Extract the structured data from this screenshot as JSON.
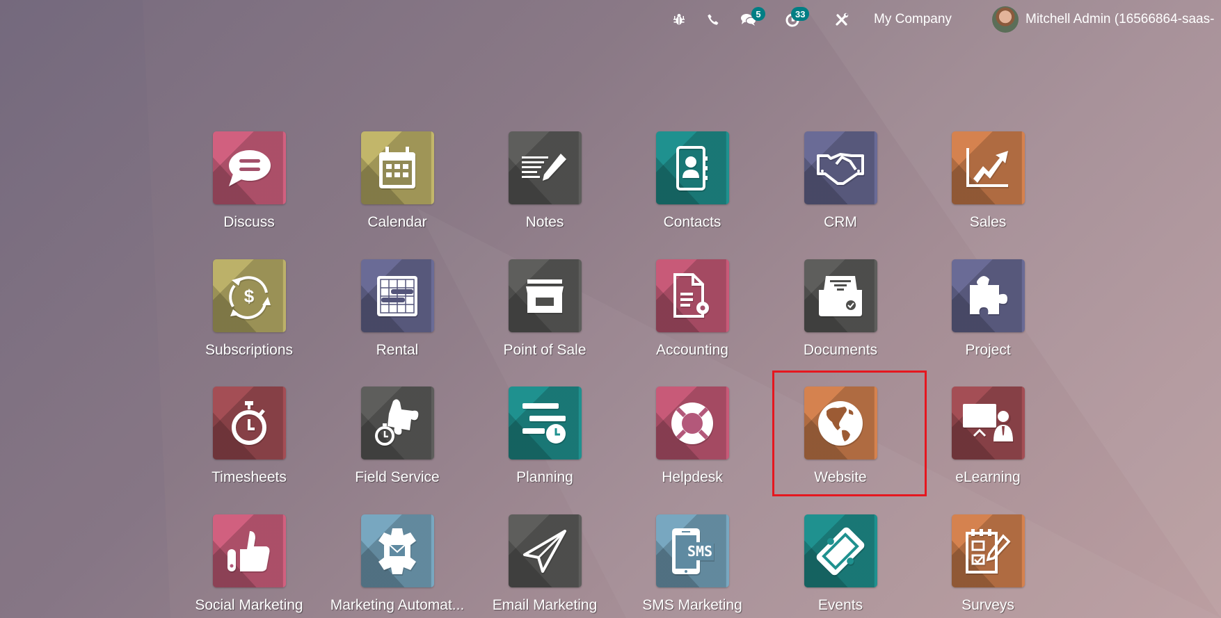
{
  "topbar": {
    "debug_icon": "bug-icon",
    "phone_icon": "phone-icon",
    "messages": {
      "icon": "chat-bubbles-icon",
      "count": "5"
    },
    "activities": {
      "icon": "clock-icon",
      "count": "33"
    },
    "tools_icon": "wrench-screwdriver-icon",
    "company": "My Company",
    "user": {
      "avatar": "user-avatar",
      "name": "Mitchell Admin (16566864-saas-"
    }
  },
  "colors": {
    "badge": "#017e84",
    "highlight": "#e5171f"
  },
  "apps": [
    {
      "label": "Discuss",
      "icon": "chat-bubble-icon",
      "color": "#d1607f"
    },
    {
      "label": "Calendar",
      "icon": "calendar-icon",
      "color": "#c2b66a"
    },
    {
      "label": "Notes",
      "icon": "notes-pencil-icon",
      "color": "#5e5e5c"
    },
    {
      "label": "Contacts",
      "icon": "address-book-icon",
      "color": "#1f918f"
    },
    {
      "label": "CRM",
      "icon": "handshake-icon",
      "color": "#6a6b96"
    },
    {
      "label": "Sales",
      "icon": "trending-chart-icon",
      "color": "#d5824f"
    },
    {
      "label": "Subscriptions",
      "icon": "recurring-dollar-icon",
      "color": "#bcb169"
    },
    {
      "label": "Rental",
      "icon": "gantt-grid-icon",
      "color": "#6a6b96"
    },
    {
      "label": "Point of Sale",
      "icon": "store-icon",
      "color": "#5e5e5c"
    },
    {
      "label": "Accounting",
      "icon": "document-gear-icon",
      "color": "#c85a78"
    },
    {
      "label": "Documents",
      "icon": "file-drawer-icon",
      "color": "#5e5e5c"
    },
    {
      "label": "Project",
      "icon": "puzzle-icon",
      "color": "#6a6b96"
    },
    {
      "label": "Timesheets",
      "icon": "stopwatch-icon",
      "color": "#a44e55"
    },
    {
      "label": "Field Service",
      "icon": "puzzle-stopwatch-icon",
      "color": "#5e5e5c"
    },
    {
      "label": "Planning",
      "icon": "planning-lines-clock-icon",
      "color": "#1f918f"
    },
    {
      "label": "Helpdesk",
      "icon": "lifebuoy-icon",
      "color": "#c85a78"
    },
    {
      "label": "Website",
      "icon": "globe-icon",
      "color": "#d5824f",
      "highlighted": true
    },
    {
      "label": "eLearning",
      "icon": "presentation-board-icon",
      "color": "#a44e55"
    },
    {
      "label": "Social Marketing",
      "icon": "thumbs-up-icon",
      "color": "#d1607f"
    },
    {
      "label": "Marketing Automat...",
      "icon": "gear-envelope-icon",
      "color": "#78a7c0"
    },
    {
      "label": "Email Marketing",
      "icon": "paper-plane-icon",
      "color": "#5e5e5c"
    },
    {
      "label": "SMS Marketing",
      "icon": "phone-sms-icon",
      "color": "#78a7c0"
    },
    {
      "label": "Events",
      "icon": "ticket-icon",
      "color": "#1f918f"
    },
    {
      "label": "Surveys",
      "icon": "checklist-pencil-icon",
      "color": "#d5824f"
    }
  ]
}
